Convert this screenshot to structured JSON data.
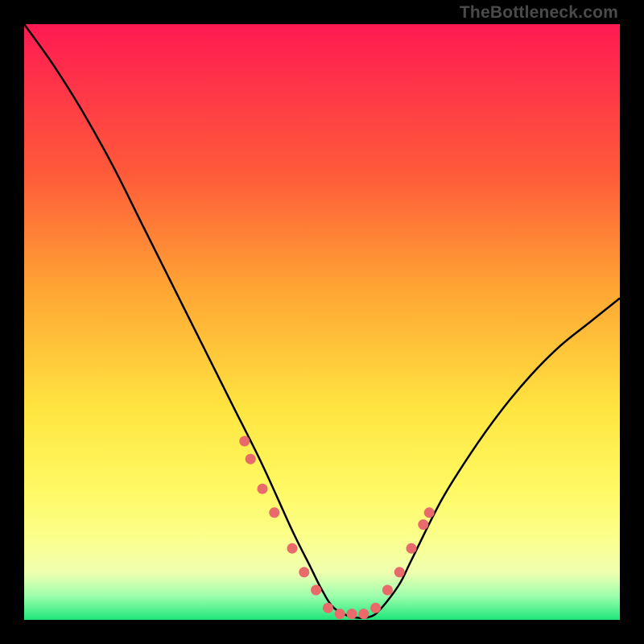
{
  "watermark": "TheBottleneck.com",
  "chart_data": {
    "type": "line",
    "title": "",
    "xlabel": "",
    "ylabel": "",
    "xlim": [
      0,
      100
    ],
    "ylim": [
      0,
      100
    ],
    "grid": false,
    "legend": false,
    "annotations": [],
    "series": [
      {
        "name": "bottleneck-curve",
        "x": [
          0,
          5,
          10,
          15,
          20,
          25,
          30,
          35,
          40,
          45,
          48,
          50,
          52,
          55,
          58,
          60,
          63,
          65,
          70,
          75,
          80,
          85,
          90,
          95,
          100
        ],
        "y": [
          100,
          93,
          85,
          76,
          66,
          56,
          46,
          36,
          26,
          15,
          9,
          5,
          2,
          0.5,
          0.5,
          2,
          6,
          10,
          20,
          28,
          35,
          41,
          46,
          50,
          54
        ],
        "color": "#000000"
      },
      {
        "name": "highlight-dots",
        "x": [
          37,
          38,
          40,
          42,
          45,
          47,
          49,
          51,
          53,
          55,
          57,
          59,
          61,
          63,
          65,
          67,
          68
        ],
        "y": [
          30,
          27,
          22,
          18,
          12,
          8,
          5,
          2,
          1,
          1,
          1,
          2,
          5,
          8,
          12,
          16,
          18
        ],
        "color": "#e86a6a"
      }
    ]
  }
}
